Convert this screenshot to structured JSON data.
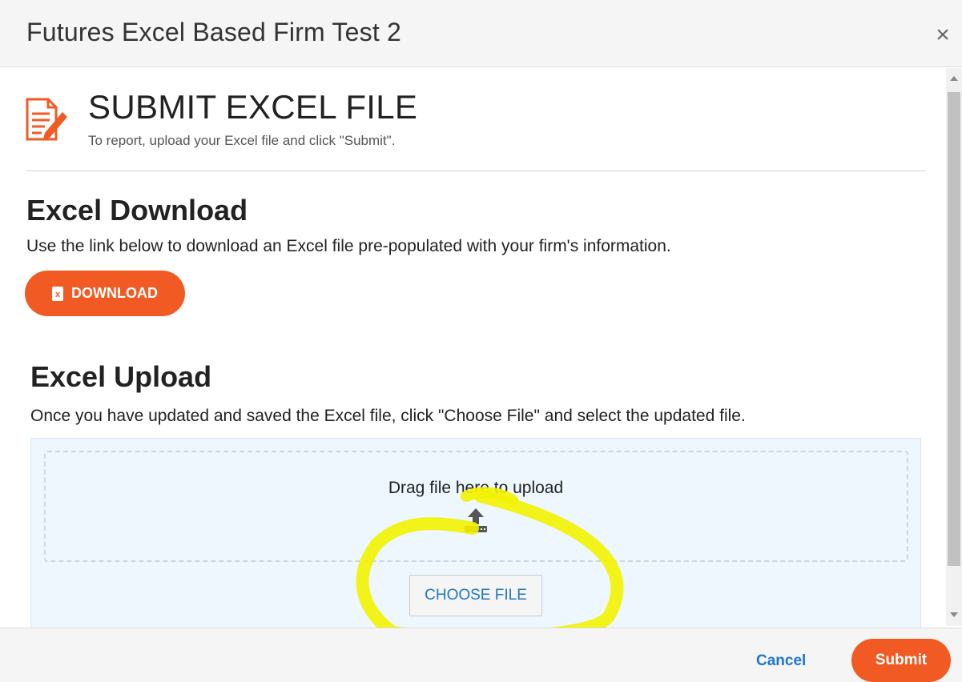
{
  "dialog": {
    "title": "Futures Excel Based Firm Test 2",
    "close_glyph": "×"
  },
  "section": {
    "title": "SUBMIT EXCEL FILE",
    "subtitle": "To report, upload your Excel file and click \"Submit\"."
  },
  "download": {
    "heading": "Excel Download",
    "description": "Use the link below to download an Excel file pre-populated with your firm's information.",
    "button_label": "DOWNLOAD",
    "button_icon": "excel-file-icon"
  },
  "upload": {
    "heading": "Excel Upload",
    "description": "Once you have updated and saved the Excel file, click \"Choose File\" and select the updated file.",
    "drag_text": "Drag file here to upload",
    "choose_label": "CHOOSE FILE",
    "icon": "upload-icon"
  },
  "footer": {
    "cancel_label": "Cancel",
    "submit_label": "Submit"
  },
  "colors": {
    "accent": "#f15a22",
    "link": "#1e76c9",
    "upload_panel_bg": "#eef7fd",
    "highlight": "#f2f200"
  }
}
